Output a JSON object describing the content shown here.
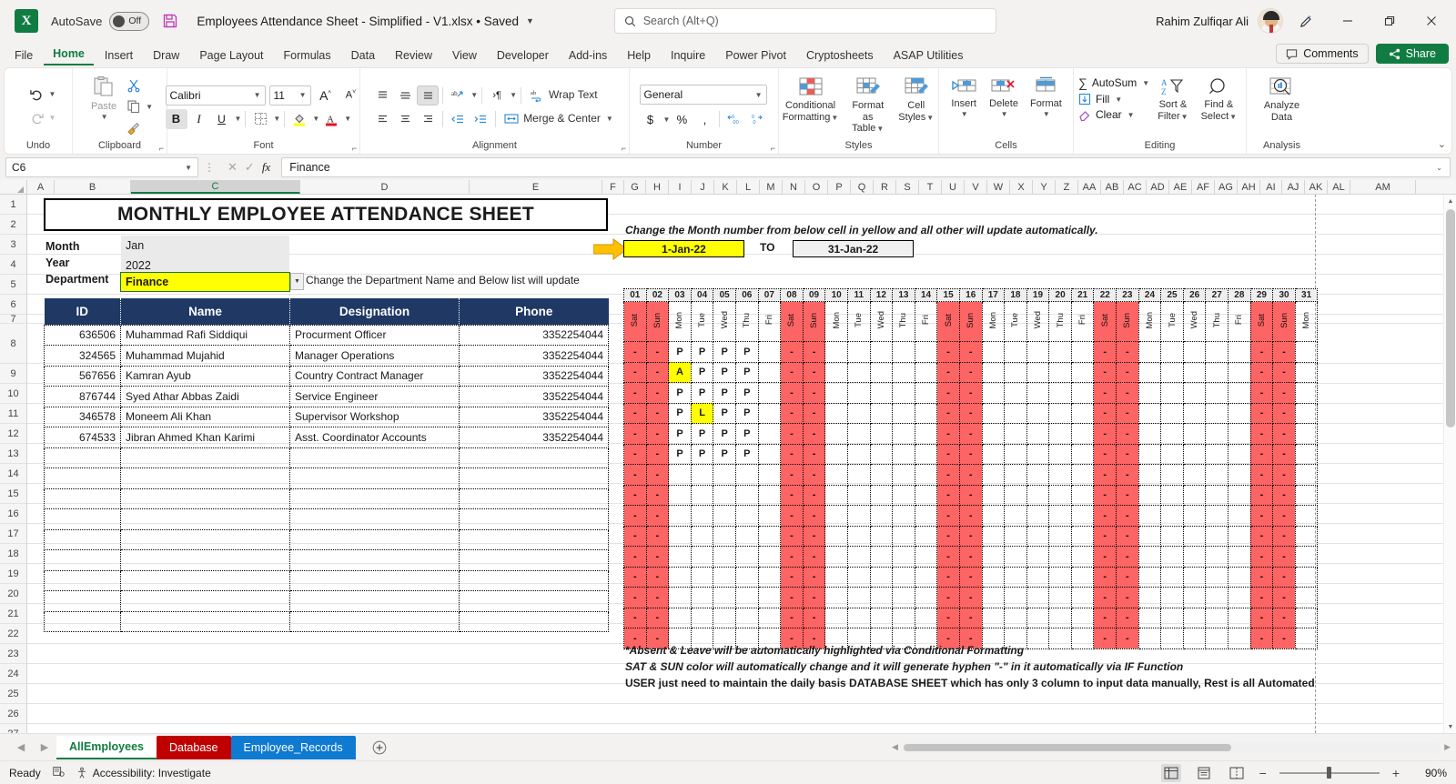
{
  "titlebar": {
    "autosave_label": "AutoSave",
    "autosave_state": "Off",
    "document_title": "Employees Attendance Sheet - Simplified - V1.xlsx • Saved",
    "search_placeholder": "Search (Alt+Q)",
    "user_name": "Rahim Zulfiqar Ali"
  },
  "ribbon_tabs": [
    "File",
    "Home",
    "Insert",
    "Draw",
    "Page Layout",
    "Formulas",
    "Data",
    "Review",
    "View",
    "Developer",
    "Add-ins",
    "Help",
    "Inquire",
    "Power Pivot",
    "Cryptosheets",
    "ASAP Utilities"
  ],
  "active_tab": "Home",
  "tabs_right": {
    "comments": "Comments",
    "share": "Share"
  },
  "ribbon": {
    "groups": [
      {
        "name": "Undo"
      },
      {
        "name": "Clipboard",
        "paste": "Paste"
      },
      {
        "name": "Font",
        "font_name": "Calibri",
        "font_size": "11"
      },
      {
        "name": "Alignment",
        "wrap_text": "Wrap Text",
        "merge_center": "Merge & Center"
      },
      {
        "name": "Number",
        "format": "General"
      },
      {
        "name": "Styles",
        "conditional_formatting": "Conditional\nFormatting",
        "format_as_table": "Format as\nTable",
        "cell_styles": "Cell\nStyles"
      },
      {
        "name": "Cells",
        "insert": "Insert",
        "delete": "Delete",
        "format": "Format"
      },
      {
        "name": "Editing",
        "autosum": "AutoSum",
        "fill": "Fill",
        "clear": "Clear",
        "sort_filter": "Sort &\nFilter",
        "find_select": "Find &\nSelect"
      },
      {
        "name": "Analysis",
        "analyze_data": "Analyze\nData"
      }
    ],
    "labels": {
      "undo": "Undo",
      "clipboard": "Clipboard",
      "paste": "Paste",
      "font": "Font",
      "alignment": "Alignment",
      "wrap_text": "Wrap Text",
      "merge_center": "Merge & Center",
      "number": "Number",
      "number_format": "General",
      "styles": "Styles",
      "cond_fmt_l1": "Conditional",
      "cond_fmt_l2": "Formatting",
      "fmt_table_l1": "Format as",
      "fmt_table_l2": "Table",
      "cell_styles_l1": "Cell",
      "cell_styles_l2": "Styles",
      "cells": "Cells",
      "insert": "Insert",
      "delete": "Delete",
      "format": "Format",
      "editing": "Editing",
      "autosum": "AutoSum",
      "fill": "Fill",
      "clear": "Clear",
      "sort_filter_l1": "Sort &",
      "sort_filter_l2": "Filter",
      "find_select_l1": "Find &",
      "find_select_l2": "Select",
      "analysis": "Analysis",
      "analyze_l1": "Analyze",
      "analyze_l2": "Data",
      "font_name": "Calibri",
      "font_size": "11",
      "bold": "B",
      "italic": "I",
      "underline": "U"
    }
  },
  "formula_bar": {
    "name_box": "C6",
    "formula": "Finance"
  },
  "grid": {
    "column_letters": [
      "A",
      "B",
      "C",
      "D",
      "E",
      "F",
      "G",
      "H",
      "I",
      "J",
      "K",
      "L",
      "M",
      "N",
      "O",
      "P",
      "Q",
      "R",
      "S",
      "T",
      "U",
      "V",
      "W",
      "X",
      "Y",
      "Z",
      "AA",
      "AB",
      "AC",
      "AD",
      "AE",
      "AF",
      "AG",
      "AH",
      "AI",
      "AJ",
      "AK",
      "AL",
      "AM"
    ],
    "selected_column": "C",
    "row_numbers": [
      "1",
      "2",
      "3",
      "4",
      "5",
      "6",
      "7",
      "8",
      "9",
      "10",
      "11",
      "12",
      "13",
      "14",
      "15",
      "16",
      "17",
      "18",
      "19",
      "20",
      "21",
      "22",
      "23",
      "24",
      "25",
      "26",
      "27"
    ]
  },
  "report": {
    "title": "MONTHLY EMPLOYEE ATTENDANCE SHEET",
    "fields": [
      {
        "label": "Month",
        "value": "Jan"
      },
      {
        "label": "Year",
        "value": "2022"
      },
      {
        "label": "Department",
        "value": "Finance"
      }
    ],
    "department_note": "Change the Department Name and Below list will update",
    "month_note": "Change the Month number from below cell in yellow and all other will update automatically.",
    "date_from": "1-Jan-22",
    "date_to_label": "TO",
    "date_to": "31-Jan-22",
    "table_headers": [
      "ID",
      "Name",
      "Designation",
      "Phone"
    ],
    "employees": [
      {
        "id": "636506",
        "name": "Muhammad Rafi Siddiqui",
        "designation": "Procurment Officer",
        "phone": "3352254044"
      },
      {
        "id": "324565",
        "name": "Muhammad Mujahid",
        "designation": "Manager Operations",
        "phone": "3352254044"
      },
      {
        "id": "567656",
        "name": "Kamran Ayub",
        "designation": "Country Contract Manager",
        "phone": "3352254044"
      },
      {
        "id": "876744",
        "name": "Syed Athar Abbas Zaidi",
        "designation": "Service Engineer",
        "phone": "3352254044"
      },
      {
        "id": "346578",
        "name": "Moneem Ali Khan",
        "designation": "Supervisor Workshop",
        "phone": "3352254044"
      },
      {
        "id": "674533",
        "name": "Jibran Ahmed Khan Karimi",
        "designation": "Asst. Coordinator Accounts",
        "phone": "3352254044"
      }
    ],
    "legend": [
      "*Absent & Leave will be automatically highlighted via Conditional Formatting",
      "SAT & SUN color will automatically change and it will generate hyphen \"-\" in it automatically via IF Function",
      "USER just need to maintain the daily basis DATABASE SHEET which has only 3 column to input data manually, Rest is all Automated"
    ],
    "colors": {
      "header_blue": "#1f3864",
      "weekend_red": "#fd6464",
      "highlight_yellow": "#ffff00",
      "arrow_orange": "#ffc000"
    }
  },
  "attendance": {
    "days": [
      "01",
      "02",
      "03",
      "04",
      "05",
      "06",
      "07",
      "08",
      "09",
      "10",
      "11",
      "12",
      "13",
      "14",
      "15",
      "16",
      "17",
      "18",
      "19",
      "20",
      "21",
      "22",
      "23",
      "24",
      "25",
      "26",
      "27",
      "28",
      "29",
      "30",
      "31"
    ],
    "dow": [
      "Sat",
      "Sun",
      "Mon",
      "Tue",
      "Wed",
      "Thu",
      "Fri",
      "Sat",
      "Sun",
      "Mon",
      "Tue",
      "Wed",
      "Thu",
      "Fri",
      "Sat",
      "Sun",
      "Mon",
      "Tue",
      "Wed",
      "Thu",
      "Fri",
      "Sat",
      "Sun",
      "Mon",
      "Tue",
      "Wed",
      "Thu",
      "Fri",
      "Sat",
      "Sun",
      "Mon"
    ],
    "weekend_indices": [
      0,
      1,
      7,
      8,
      14,
      15,
      21,
      22,
      28,
      29
    ],
    "weekend_mark": "-",
    "rows": [
      {
        "marks": [
          "-",
          "-",
          "P",
          "P",
          "P",
          "P",
          "",
          "-",
          "-",
          "",
          "",
          "",
          "",
          "",
          "-",
          "-",
          "",
          "",
          "",
          "",
          "",
          "-",
          "-",
          "",
          "",
          "",
          "",
          "",
          "-",
          "-",
          ""
        ]
      },
      {
        "marks": [
          "-",
          "-",
          "A",
          "P",
          "P",
          "P",
          "",
          "-",
          "-",
          "",
          "",
          "",
          "",
          "",
          "-",
          "-",
          "",
          "",
          "",
          "",
          "",
          "-",
          "-",
          "",
          "",
          "",
          "",
          "",
          "-",
          "-",
          ""
        ]
      },
      {
        "marks": [
          "-",
          "-",
          "P",
          "P",
          "P",
          "P",
          "",
          "-",
          "-",
          "",
          "",
          "",
          "",
          "",
          "-",
          "-",
          "",
          "",
          "",
          "",
          "",
          "-",
          "-",
          "",
          "",
          "",
          "",
          "",
          "-",
          "-",
          ""
        ]
      },
      {
        "marks": [
          "-",
          "-",
          "P",
          "L",
          "P",
          "P",
          "",
          "-",
          "-",
          "",
          "",
          "",
          "",
          "",
          "-",
          "-",
          "",
          "",
          "",
          "",
          "",
          "-",
          "-",
          "",
          "",
          "",
          "",
          "",
          "-",
          "-",
          ""
        ]
      },
      {
        "marks": [
          "-",
          "-",
          "P",
          "P",
          "P",
          "P",
          "",
          "-",
          "-",
          "",
          "",
          "",
          "",
          "",
          "-",
          "-",
          "",
          "",
          "",
          "",
          "",
          "-",
          "-",
          "",
          "",
          "",
          "",
          "",
          "-",
          "-",
          ""
        ]
      },
      {
        "marks": [
          "-",
          "-",
          "P",
          "P",
          "P",
          "P",
          "",
          "-",
          "-",
          "",
          "",
          "",
          "",
          "",
          "-",
          "-",
          "",
          "",
          "",
          "",
          "",
          "-",
          "-",
          "",
          "",
          "",
          "",
          "",
          "-",
          "-",
          ""
        ]
      },
      {
        "marks": [
          "-",
          "-",
          "",
          "",
          "",
          "",
          "",
          "-",
          "-",
          "",
          "",
          "",
          "",
          "",
          "-",
          "-",
          "",
          "",
          "",
          "",
          "",
          "-",
          "-",
          "",
          "",
          "",
          "",
          "",
          "-",
          "-",
          ""
        ]
      },
      {
        "marks": [
          "-",
          "-",
          "",
          "",
          "",
          "",
          "",
          "-",
          "-",
          "",
          "",
          "",
          "",
          "",
          "-",
          "-",
          "",
          "",
          "",
          "",
          "",
          "-",
          "-",
          "",
          "",
          "",
          "",
          "",
          "-",
          "-",
          ""
        ]
      },
      {
        "marks": [
          "-",
          "-",
          "",
          "",
          "",
          "",
          "",
          "-",
          "-",
          "",
          "",
          "",
          "",
          "",
          "-",
          "-",
          "",
          "",
          "",
          "",
          "",
          "-",
          "-",
          "",
          "",
          "",
          "",
          "",
          "-",
          "-",
          ""
        ]
      },
      {
        "marks": [
          "-",
          "-",
          "",
          "",
          "",
          "",
          "",
          "-",
          "-",
          "",
          "",
          "",
          "",
          "",
          "-",
          "-",
          "",
          "",
          "",
          "",
          "",
          "-",
          "-",
          "",
          "",
          "",
          "",
          "",
          "-",
          "-",
          ""
        ]
      },
      {
        "marks": [
          "-",
          "-",
          "",
          "",
          "",
          "",
          "",
          "-",
          "-",
          "",
          "",
          "",
          "",
          "",
          "-",
          "-",
          "",
          "",
          "",
          "",
          "",
          "-",
          "-",
          "",
          "",
          "",
          "",
          "",
          "-",
          "-",
          ""
        ]
      },
      {
        "marks": [
          "-",
          "-",
          "",
          "",
          "",
          "",
          "",
          "-",
          "-",
          "",
          "",
          "",
          "",
          "",
          "-",
          "-",
          "",
          "",
          "",
          "",
          "",
          "-",
          "-",
          "",
          "",
          "",
          "",
          "",
          "-",
          "-",
          ""
        ]
      },
      {
        "marks": [
          "-",
          "-",
          "",
          "",
          "",
          "",
          "",
          "-",
          "-",
          "",
          "",
          "",
          "",
          "",
          "-",
          "-",
          "",
          "",
          "",
          "",
          "",
          "-",
          "-",
          "",
          "",
          "",
          "",
          "",
          "-",
          "-",
          ""
        ]
      },
      {
        "marks": [
          "-",
          "-",
          "",
          "",
          "",
          "",
          "",
          "-",
          "-",
          "",
          "",
          "",
          "",
          "",
          "-",
          "-",
          "",
          "",
          "",
          "",
          "",
          "-",
          "-",
          "",
          "",
          "",
          "",
          "",
          "-",
          "-",
          ""
        ]
      },
      {
        "marks": [
          "-",
          "-",
          "",
          "",
          "",
          "",
          "",
          "-",
          "-",
          "",
          "",
          "",
          "",
          "",
          "-",
          "-",
          "",
          "",
          "",
          "",
          "",
          "-",
          "-",
          "",
          "",
          "",
          "",
          "",
          "-",
          "-",
          ""
        ]
      }
    ],
    "highlights": {
      "1_2": "A",
      "3_3": "L"
    }
  },
  "sheet_tabs": [
    {
      "label": "AllEmployees",
      "style": "active"
    },
    {
      "label": "Database",
      "style": "red"
    },
    {
      "label": "Employee_Records",
      "style": "blue"
    }
  ],
  "status_bar": {
    "ready": "Ready",
    "accessibility": "Accessibility: Investigate",
    "zoom": "90%"
  }
}
